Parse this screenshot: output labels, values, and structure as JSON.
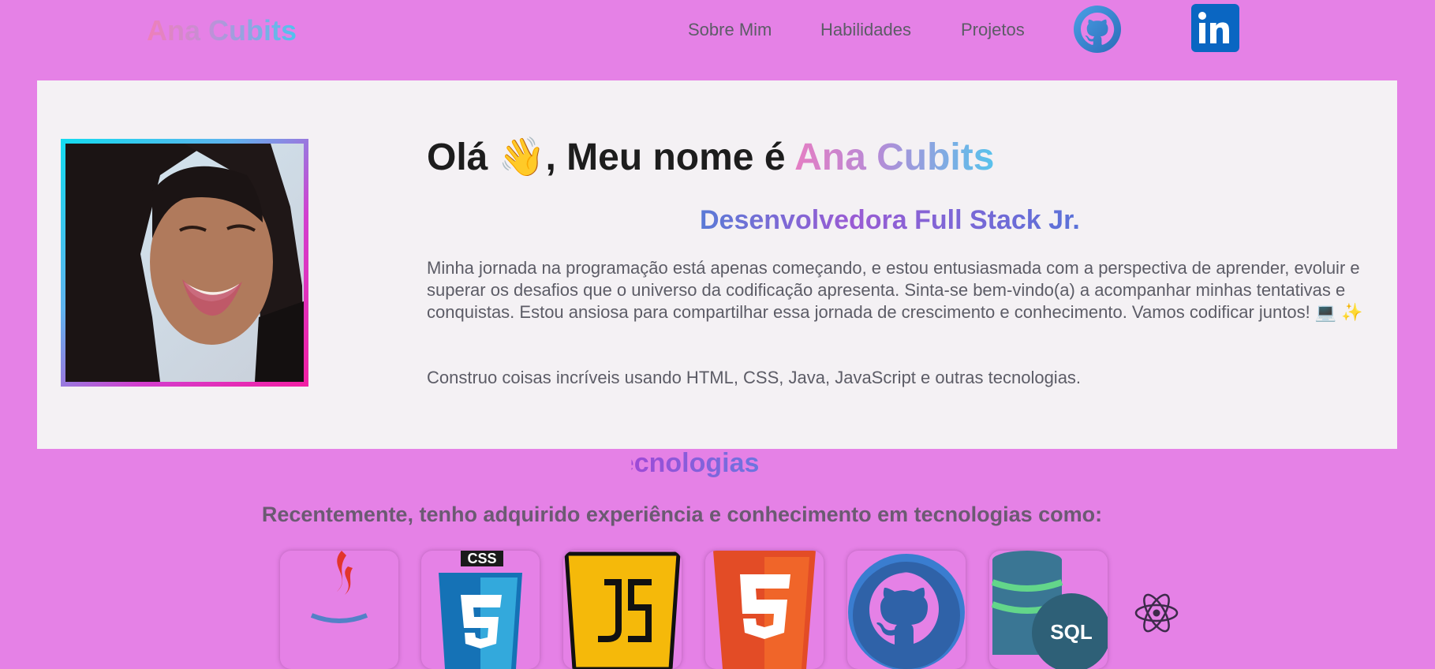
{
  "header": {
    "logo": "Ana Cubits",
    "nav": [
      "Sobre Mim",
      "Habilidades",
      "Projetos"
    ],
    "social": [
      "github-icon",
      "linkedin-icon"
    ]
  },
  "hero": {
    "greeting_prefix": "Olá ",
    "greeting_emoji": "👋",
    "greeting_middle": ", Meu nome é ",
    "greeting_name": "Ana Cubits",
    "subtitle": "Desenvolvedora Full Stack Jr.",
    "bio": "Minha jornada na programação está apenas começando, e estou entusiasmada com a perspectiva de aprender, evoluir e superar os desafios que o universo da codificação apresenta. Sinta-se bem-vindo(a) a acompanhar minhas tentativas e conquistas. Estou ansiosa para compartilhar essa jornada de crescimento e conhecimento. Vamos codificar juntos! 💻 ✨",
    "build": "Construo coisas incríveis usando HTML, CSS, Java, JavaScript e outras tecnologias."
  },
  "tech": {
    "title": "Tecnologias",
    "subtitle": "Recentemente, tenho adquirido experiência e conhecimento em tecnologias como:",
    "icons": [
      "java-icon",
      "css3-icon",
      "javascript-icon",
      "html5-icon",
      "github-icon",
      "sql-database-icon",
      "react-icon"
    ],
    "css_label": "CSS",
    "sql_label": "SQL"
  },
  "colors": {
    "background": "#e581e6",
    "card": "#f4f1f4",
    "text": "#5c5c66"
  }
}
